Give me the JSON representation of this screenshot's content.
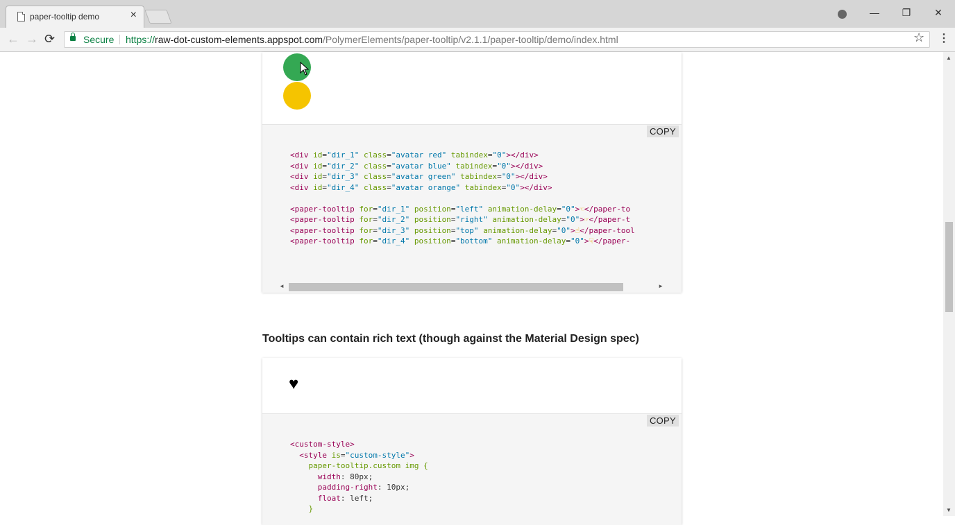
{
  "browser": {
    "tab_title": "paper-tooltip demo",
    "tab_close": "×",
    "window_buttons": {
      "minimize": "—",
      "restore": "❐",
      "close": "✕"
    },
    "nav": {
      "back": "←",
      "forward": "→",
      "reload": "⟳"
    },
    "secure_label": "Secure",
    "url_scheme": "https://",
    "url_host": "raw-dot-custom-elements.appspot.com",
    "url_path": "/PolymerElements/paper-tooltip/v2.1.1/paper-tooltip/demo/index.html",
    "star": "☆",
    "menu": "⋮"
  },
  "colors": {
    "avatar_green": "#34a853",
    "avatar_orange": "#f5c400",
    "secure_green": "#0b8043"
  },
  "demo1": {
    "copy_label": "COPY"
  },
  "demo2": {
    "title": "Tooltips can contain rich text (though against the Material Design spec)",
    "heart": "♥",
    "copy_label": "COPY"
  },
  "scrollbar": {
    "up": "▲",
    "down": "▼",
    "left": "◄",
    "right": "►"
  }
}
